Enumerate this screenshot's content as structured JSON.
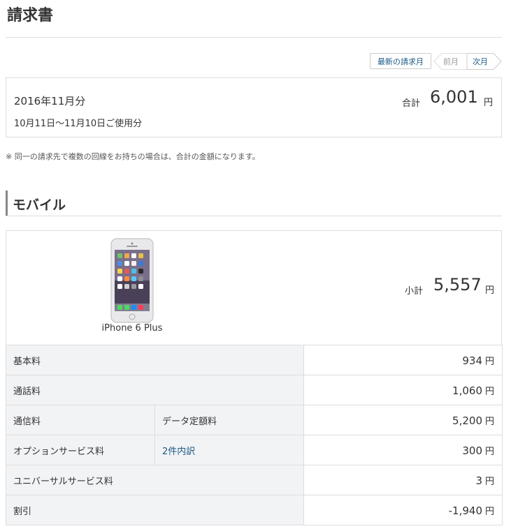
{
  "page": {
    "title": "請求書"
  },
  "nav": {
    "latest_label": "最新の請求月",
    "prev_label": "前月",
    "next_label": "次月"
  },
  "summary": {
    "period": "2016年11月分",
    "usage_range": "10月11日～11月10日ご使用分",
    "total_label": "合計",
    "total_amount": "6,001",
    "currency": "円"
  },
  "note": "※ 同一の請求先で複数の回線をお持ちの場合は、合計の金額になります。",
  "section": {
    "title": "モバイル",
    "device_name": "iPhone 6 Plus",
    "device_icon": "iphone-image",
    "subtotal_label": "小計",
    "subtotal_amount": "5,557",
    "currency": "円"
  },
  "fees": [
    {
      "label": "基本料",
      "detail": "",
      "amount": "934",
      "currency": "円"
    },
    {
      "label": "通話料",
      "detail": "",
      "amount": "1,060",
      "currency": "円"
    },
    {
      "label": "通信料",
      "detail": "データ定額料",
      "amount": "5,200",
      "currency": "円"
    },
    {
      "label": "オプションサービス料",
      "detail": "2件内訳",
      "amount": "300",
      "currency": "円"
    },
    {
      "label": "ユニバーサルサービス料",
      "detail": "",
      "amount": "3",
      "currency": "円"
    },
    {
      "label": "割引",
      "detail": "",
      "amount": "-1,940",
      "currency": "円"
    }
  ],
  "colors": {
    "link": "#1a5a85",
    "negative": "#d9446e",
    "label_bg": "#f2f3f5",
    "border": "#dddddd"
  }
}
